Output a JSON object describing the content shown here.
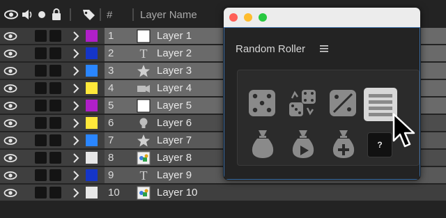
{
  "header": {
    "number_label": "#",
    "layer_name_label": "Layer Name"
  },
  "layers": [
    {
      "num": "1",
      "name": "Layer 1",
      "label_color": "#b01fc9",
      "type_icon": "solid-white-icon",
      "selected": true
    },
    {
      "num": "2",
      "name": "Layer 2",
      "label_color": "#1535c8",
      "type_icon": "text-icon",
      "selected": true
    },
    {
      "num": "3",
      "name": "Layer 3",
      "label_color": "#2a86ff",
      "type_icon": "shape-star-icon",
      "selected": true
    },
    {
      "num": "4",
      "name": "Layer 4",
      "label_color": "#ffe83a",
      "type_icon": "camera-icon",
      "selected": true
    },
    {
      "num": "5",
      "name": "Layer 5",
      "label_color": "#b01fc9",
      "type_icon": "solid-white-icon",
      "selected": true
    },
    {
      "num": "6",
      "name": "Layer 6",
      "label_color": "#ffe83a",
      "type_icon": "light-bulb-icon",
      "selected": false
    },
    {
      "num": "7",
      "name": "Layer 7",
      "label_color": "#2a86ff",
      "type_icon": "shape-star-icon",
      "selected": false
    },
    {
      "num": "8",
      "name": "Layer 8",
      "label_color": "#e8e8e8",
      "type_icon": "precomp-icon",
      "selected": false
    },
    {
      "num": "9",
      "name": "Layer 9",
      "label_color": "#1535c8",
      "type_icon": "text-icon",
      "selected": false
    },
    {
      "num": "10",
      "name": "Layer 10",
      "label_color": "#e8e8e8",
      "type_icon": "precomp-icon",
      "selected": false
    }
  ],
  "panel": {
    "title": "Random Roller",
    "help_label": "?",
    "buttons": [
      "dice-icon",
      "reroll-dice-icon",
      "gradient-dice-icon",
      "list-lines-icon",
      "money-bag-icon",
      "money-bag-play-icon",
      "money-bag-plus-icon"
    ],
    "traffic_colors": [
      "#ff5f57",
      "#febc2e",
      "#28c840"
    ],
    "accent": "#3b6fa8"
  }
}
